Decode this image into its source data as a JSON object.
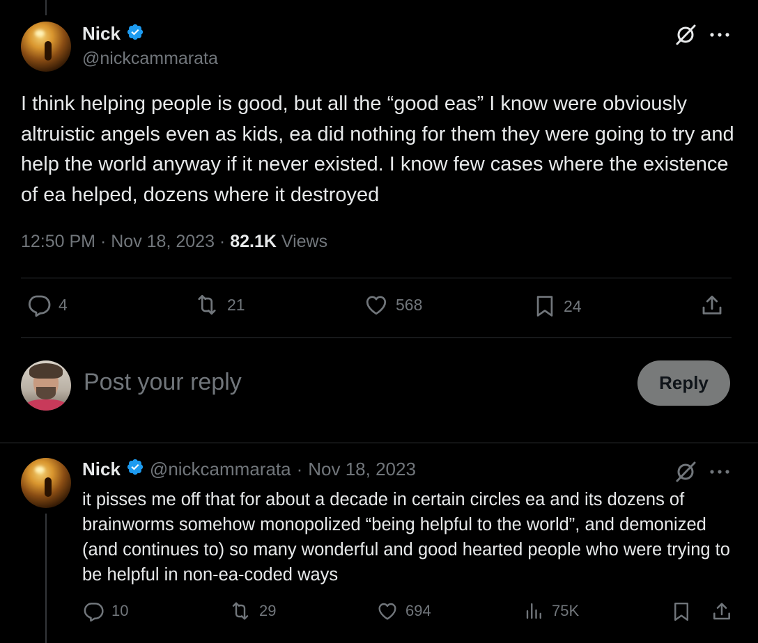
{
  "tweet": {
    "author_name": "Nick",
    "author_handle": "@nickcammarata",
    "text": "I think helping people is good, but all the “good eas” I know were obviously altruistic angels even as kids, ea did nothing for them they were going to try and help the world anyway if it never existed. I know few cases where the existence of ea helped, dozens where it destroyed",
    "time": "12:50 PM",
    "date": "Nov 18, 2023",
    "views_count": "82.1K",
    "views_label": "Views",
    "separator": "·",
    "counts": {
      "replies": "4",
      "reposts": "21",
      "likes": "568",
      "bookmarks": "24"
    }
  },
  "reply_box": {
    "placeholder": "Post your reply",
    "button_label": "Reply"
  },
  "reply": {
    "author_name": "Nick",
    "author_handle": "@nickcammarata",
    "separator": "·",
    "date": "Nov 18, 2023",
    "text": "it pisses me off that for about a decade in certain circles ea and its dozens of brainworms somehow monopolized “being helpful to the world”, and demonized (and continues to) so many wonderful and good hearted people who were trying to be helpful in non-ea-coded ways",
    "counts": {
      "replies": "10",
      "reposts": "29",
      "likes": "694",
      "views": "75K"
    }
  },
  "colors": {
    "background": "#000000",
    "text": "#e7e9ea",
    "secondary_text": "#71767b",
    "verified_blue": "#1d9bf0",
    "divider": "#2f3336",
    "reply_button_bg": "#787a7a"
  },
  "icons": {
    "verified": "verified-badge-icon",
    "grok": "grok-icon",
    "more": "more-icon",
    "reply": "reply-icon",
    "repost": "repost-icon",
    "like": "like-icon",
    "bookmark": "bookmark-icon",
    "share": "share-icon",
    "views": "views-icon"
  }
}
